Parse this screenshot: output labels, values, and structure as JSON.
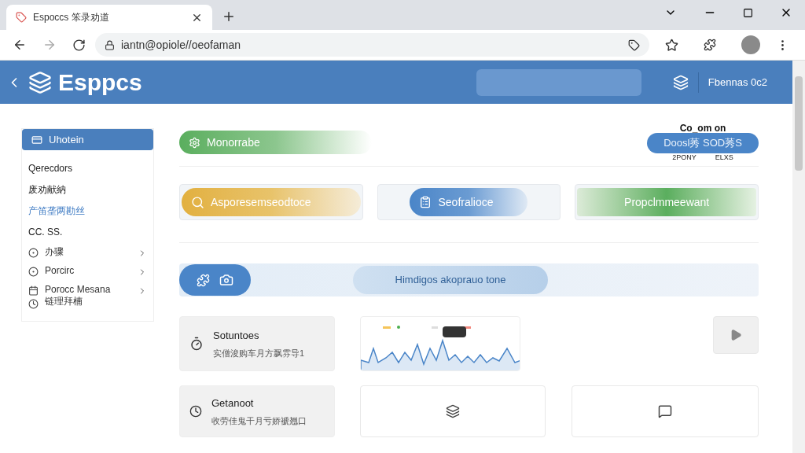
{
  "browser": {
    "tab_title": "Espoccs 笨录劝道",
    "url": "iantn@opiole//oeofaman"
  },
  "header": {
    "title": "Esppcs",
    "user": "Fbennas 0c2"
  },
  "sidebar": {
    "items": [
      {
        "label": "Uhotein",
        "kind": "header",
        "selected": true
      },
      {
        "label": "Qerecdors",
        "kind": "plain",
        "selected": false
      },
      {
        "label": "废劝献納",
        "kind": "plain",
        "selected": false
      },
      {
        "label": "产笛垄两勘丝",
        "kind": "link",
        "selected": false
      },
      {
        "label": "CC. SS.",
        "kind": "plain",
        "selected": false
      },
      {
        "label": "办骤",
        "kind": "nav",
        "selected": false
      },
      {
        "label": "Porcirc",
        "kind": "nav",
        "selected": false
      },
      {
        "label": "Porocc Mesana",
        "sublabel": "链理拜楠",
        "kind": "nav",
        "selected": false
      }
    ]
  },
  "top": {
    "pill": "Monorrabe",
    "caption": "Co_om on",
    "button": "Doosl莠 SOD莠S",
    "notes": [
      "2PONY",
      "ЕLXS"
    ]
  },
  "actions": [
    {
      "label": "Asporesemseodtoce",
      "kind": "search"
    },
    {
      "label": "Seofralioce",
      "kind": "clipboard"
    },
    {
      "label": "Propclmmeewant",
      "kind": "plain"
    }
  ],
  "banner": {
    "pill": "Himdigos akoprauo tone"
  },
  "cards": [
    {
      "title": "Sotuntoes",
      "subtitle": "实僧浚购车月方飘雰导1"
    },
    {
      "title": "Getanoot",
      "subtitle": "收劳佳鬼干月亏娇褫翘口"
    }
  ]
}
